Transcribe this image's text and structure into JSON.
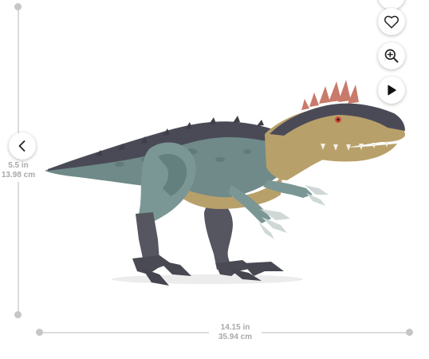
{
  "dimensions": {
    "height_in": "5.5 in",
    "height_cm": "13.98 cm",
    "width_in": "14.15 in",
    "width_cm": "35.94 cm"
  },
  "controls": {
    "favorite_icon": "heart-icon",
    "zoom_icon": "zoom-in-icon",
    "video_icon": "play-icon",
    "previous_icon": "chevron-left-icon"
  },
  "colors": {
    "ruler": "#dcdcdc",
    "ruler_dot": "#c6c6c6",
    "measure_text": "#a9a9a9",
    "toy_body": "#6f8a88",
    "toy_back": "#4a4a57",
    "toy_belly": "#b8a06a",
    "toy_crest": "#c97a6a"
  }
}
